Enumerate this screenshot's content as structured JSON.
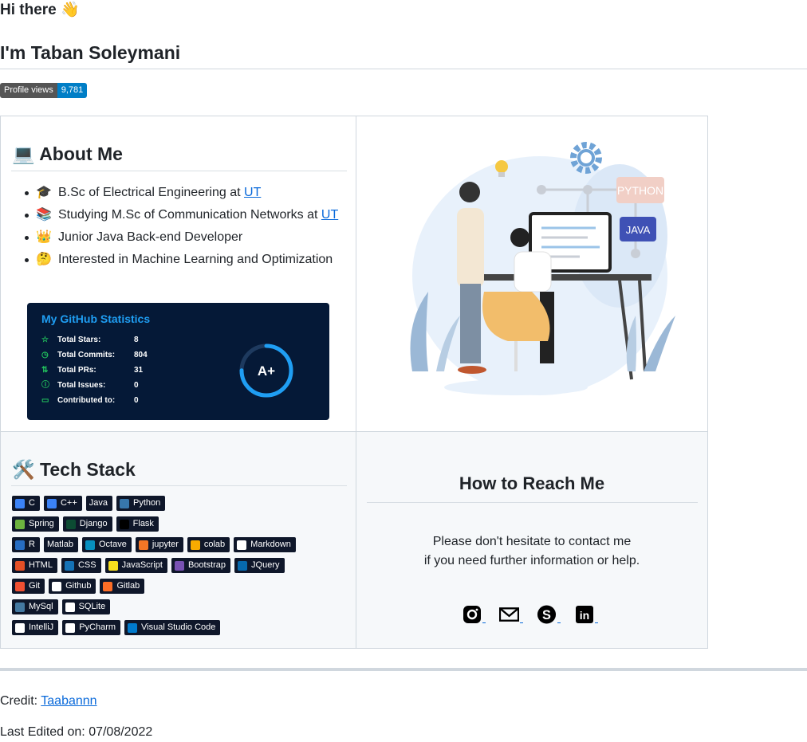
{
  "header": {
    "greeting": "Hi there 👋",
    "name": "I'm Taban Soleymani"
  },
  "profile_views": {
    "label": "Profile views",
    "value": "9,781"
  },
  "about": {
    "icon": "laptop-icon",
    "emoji": "💻",
    "title": "About Me",
    "items": [
      {
        "emoji": "🎓",
        "icon": "graduation-cap-icon",
        "text": "B.Sc of Electrical Engineering at ",
        "link": "UT"
      },
      {
        "emoji": "📚",
        "icon": "books-icon",
        "text": "Studying M.Sc of Communication Networks at ",
        "link": "UT"
      },
      {
        "emoji": "👑",
        "icon": "crown-icon",
        "text": "Junior Java Back-end Developer",
        "link": ""
      },
      {
        "emoji": "🤔",
        "icon": "thinking-face-icon",
        "text": "Interested in Machine Learning and Optimization",
        "link": ""
      }
    ]
  },
  "stats": {
    "title": "My GitHub Statistics",
    "rows": [
      {
        "icon": "star-icon",
        "label": "Total Stars:",
        "value": "8"
      },
      {
        "icon": "history-icon",
        "label": "Total Commits:",
        "value": "804"
      },
      {
        "icon": "pull-request-icon",
        "label": "Total PRs:",
        "value": "31"
      },
      {
        "icon": "issue-icon",
        "label": "Total Issues:",
        "value": "0"
      },
      {
        "icon": "repo-icon",
        "label": "Contributed to:",
        "value": "0"
      }
    ],
    "rank": "A+",
    "rank_fraction": 0.75,
    "colors": {
      "background": "#051937",
      "title": "#1f9ef3",
      "ring": "#1f9ef3"
    }
  },
  "illustration": {
    "icon": "developer-illustration",
    "labels": [
      "PYTHON",
      "JAVA"
    ]
  },
  "tech": {
    "emoji": "🛠️",
    "icon": "tools-icon",
    "title": "Tech Stack",
    "rows": [
      [
        {
          "label": "C",
          "icon": "c-icon",
          "color": "#3b82f6"
        },
        {
          "label": "C++",
          "icon": "cpp-icon",
          "color": "#3b82f6"
        },
        {
          "label": "Java",
          "icon": "",
          "color": ""
        },
        {
          "label": "Python",
          "icon": "python-icon",
          "color": "#3776ab"
        }
      ],
      [
        {
          "label": "Spring",
          "icon": "spring-icon",
          "color": "#6db33f"
        },
        {
          "label": "Django",
          "icon": "django-icon",
          "color": "#0c4b33"
        },
        {
          "label": "Flask",
          "icon": "flask-icon",
          "color": "#000000"
        }
      ],
      [
        {
          "label": "R",
          "icon": "r-icon",
          "color": "#276dc3"
        },
        {
          "label": "Matlab",
          "icon": "",
          "color": ""
        },
        {
          "label": "Octave",
          "icon": "octave-icon",
          "color": "#0790c0"
        },
        {
          "label": "jupyter",
          "icon": "jupyter-icon",
          "color": "#f37626"
        },
        {
          "label": "colab",
          "icon": "colab-icon",
          "color": "#f9ab00"
        },
        {
          "label": "Markdown",
          "icon": "markdown-icon",
          "color": "#ffffff"
        }
      ],
      [
        {
          "label": "HTML",
          "icon": "html-icon",
          "color": "#e34f26"
        },
        {
          "label": "CSS",
          "icon": "css-icon",
          "color": "#1572b6"
        },
        {
          "label": "JavaScript",
          "icon": "javascript-icon",
          "color": "#f7df1e"
        },
        {
          "label": "Bootstrap",
          "icon": "bootstrap-icon",
          "color": "#7952b3"
        },
        {
          "label": "JQuery",
          "icon": "jquery-icon",
          "color": "#0769ad"
        }
      ],
      [
        {
          "label": "Git",
          "icon": "git-icon",
          "color": "#f05032"
        },
        {
          "label": "Github",
          "icon": "github-icon",
          "color": "#ffffff"
        },
        {
          "label": "Gitlab",
          "icon": "gitlab-icon",
          "color": "#fc6d26"
        }
      ],
      [
        {
          "label": "MySql",
          "icon": "mysql-icon",
          "color": "#4479a1"
        },
        {
          "label": "SQLite",
          "icon": "sqlite-icon",
          "color": "#ffffff"
        }
      ],
      [
        {
          "label": "IntelliJ",
          "icon": "intellij-icon",
          "color": "#ffffff"
        },
        {
          "label": "PyCharm",
          "icon": "pycharm-icon",
          "color": "#ffffff"
        },
        {
          "label": "Visual Studio Code",
          "icon": "vscode-icon",
          "color": "#007acc"
        }
      ]
    ]
  },
  "reach": {
    "title": "How to Reach Me",
    "line1": "Please don't hesitate to contact me",
    "line2": "if you need further information or help.",
    "contacts": [
      {
        "icon": "instagram-icon"
      },
      {
        "icon": "email-icon"
      },
      {
        "icon": "skype-icon"
      },
      {
        "icon": "linkedin-icon"
      }
    ]
  },
  "footer": {
    "credit_label": "Credit: ",
    "credit_link": "Taabannn",
    "edited": "Last Edited on: 07/08/2022"
  }
}
